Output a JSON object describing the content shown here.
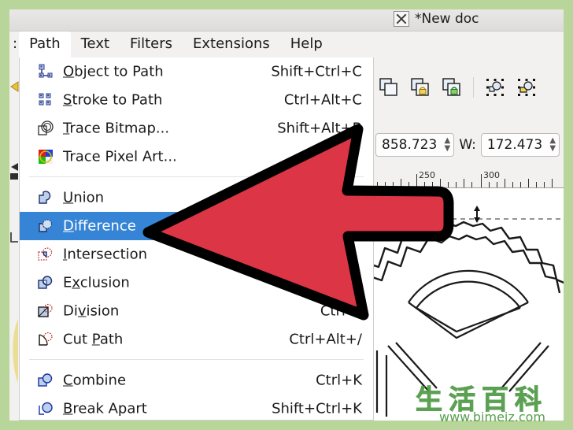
{
  "window": {
    "title": "*New doc",
    "app_icon": "x-window-icon"
  },
  "menubar": {
    "clipped_left": ":",
    "items": [
      {
        "label": "Path",
        "active": true
      },
      {
        "label": "Text",
        "active": false
      },
      {
        "label": "Filters",
        "active": false
      },
      {
        "label": "Extensions",
        "active": false
      },
      {
        "label": "Help",
        "active": false
      }
    ]
  },
  "path_menu": {
    "groups": [
      {
        "items": [
          {
            "label": "Object to Path",
            "mnemonic": "O",
            "accel": "Shift+Ctrl+C",
            "icon": "object-to-path-icon",
            "selected": false
          },
          {
            "label": "Stroke to Path",
            "mnemonic": "S",
            "accel": "Ctrl+Alt+C",
            "icon": "stroke-to-path-icon",
            "selected": false
          },
          {
            "label": "Trace Bitmap...",
            "mnemonic": "T",
            "accel": "Shift+Alt+B",
            "icon": "trace-bitmap-icon",
            "selected": false
          },
          {
            "label": "Trace Pixel Art...",
            "mnemonic": "",
            "accel": "",
            "icon": "trace-pixel-art-icon",
            "selected": false
          }
        ]
      },
      {
        "items": [
          {
            "label": "Union",
            "mnemonic": "U",
            "accel": "",
            "icon": "union-icon",
            "selected": false
          },
          {
            "label": "Difference",
            "mnemonic": "D",
            "accel": "",
            "icon": "difference-icon",
            "selected": true
          },
          {
            "label": "Intersection",
            "mnemonic": "I",
            "accel": "",
            "icon": "intersection-icon",
            "selected": false
          },
          {
            "label": "Exclusion",
            "mnemonic": "x",
            "accel": "",
            "icon": "exclusion-icon",
            "selected": false
          },
          {
            "label": "Division",
            "mnemonic": "v",
            "accel": "Ctrl+/",
            "icon": "division-icon",
            "selected": false
          },
          {
            "label": "Cut Path",
            "mnemonic": "P",
            "accel": "Ctrl+Alt+/",
            "icon": "cut-path-icon",
            "selected": false
          }
        ]
      },
      {
        "items": [
          {
            "label": "Combine",
            "mnemonic": "C",
            "accel": "Ctrl+K",
            "icon": "combine-icon",
            "selected": false
          },
          {
            "label": "Break Apart",
            "mnemonic": "B",
            "accel": "Shift+Ctrl+K",
            "icon": "break-apart-icon",
            "selected": false
          }
        ]
      }
    ]
  },
  "command_bar": {
    "buttons": [
      {
        "name": "duplicate-icon",
        "label": "Duplicate"
      },
      {
        "name": "lock-object-icon",
        "label": "Lock"
      },
      {
        "name": "unlock-object-icon",
        "label": "Unlock"
      },
      {
        "name": "separator",
        "label": ""
      },
      {
        "name": "select-same-icon",
        "label": "Select Same"
      },
      {
        "name": "select-highlight-icon",
        "label": "Select Highlighted"
      }
    ]
  },
  "tool_controls": {
    "y_value": "858.723",
    "width_label": "W:",
    "width_value": "172.473"
  },
  "ruler": {
    "labels": [
      "250",
      "300"
    ],
    "label_positions": [
      56,
      138
    ]
  },
  "annotation": {
    "arrow": "red-left-arrow",
    "points_to": "Difference"
  },
  "canvas": {
    "drawing": "gear-outline-sketch",
    "selection_handle": "vertical-resize-handle"
  },
  "watermark": {
    "chinese": "生活百科",
    "url": "www.bimeiz.com"
  },
  "colors": {
    "frame_green": "#b9d69a",
    "menu_highlight": "#3584d6",
    "arrow_red": "#dc3545",
    "arrow_outline": "#000000",
    "watermark_green": "#4f9a45",
    "panel_bg": "#f2f1f0"
  }
}
